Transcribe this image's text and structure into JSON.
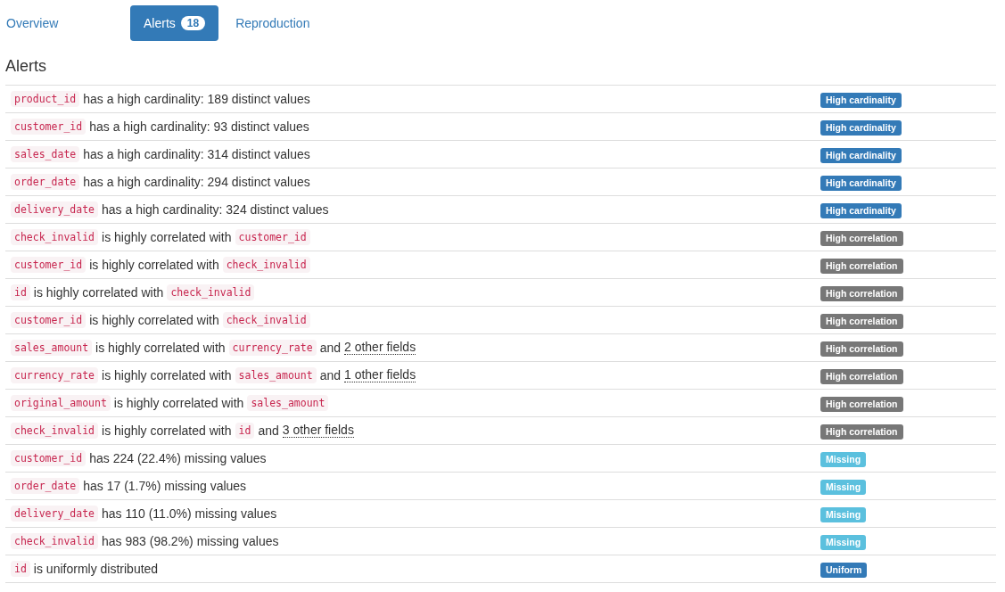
{
  "tabs": [
    {
      "label": "Overview",
      "selected": false
    },
    {
      "label": "Alerts",
      "selected": true,
      "badge": "18"
    },
    {
      "label": "Reproduction",
      "selected": false
    }
  ],
  "heading": "Alerts",
  "alerts": [
    {
      "parts": [
        {
          "kind": "code",
          "text": "product_id"
        },
        {
          "kind": "text",
          "text": "has a high cardinality: 189 distinct values"
        }
      ],
      "tag": "High cardinality",
      "color": "#337ab7"
    },
    {
      "parts": [
        {
          "kind": "code",
          "text": "customer_id"
        },
        {
          "kind": "text",
          "text": "has a high cardinality: 93 distinct values"
        }
      ],
      "tag": "High cardinality",
      "color": "#337ab7"
    },
    {
      "parts": [
        {
          "kind": "code",
          "text": "sales_date"
        },
        {
          "kind": "text",
          "text": "has a high cardinality: 314 distinct values"
        }
      ],
      "tag": "High cardinality",
      "color": "#337ab7"
    },
    {
      "parts": [
        {
          "kind": "code",
          "text": "order_date"
        },
        {
          "kind": "text",
          "text": "has a high cardinality: 294 distinct values"
        }
      ],
      "tag": "High cardinality",
      "color": "#337ab7"
    },
    {
      "parts": [
        {
          "kind": "code",
          "text": "delivery_date"
        },
        {
          "kind": "text",
          "text": "has a high cardinality: 324 distinct values"
        }
      ],
      "tag": "High cardinality",
      "color": "#337ab7"
    },
    {
      "parts": [
        {
          "kind": "code",
          "text": "check_invalid"
        },
        {
          "kind": "text",
          "text": "is highly correlated with"
        },
        {
          "kind": "code",
          "text": "customer_id"
        }
      ],
      "tag": "High correlation",
      "color": "#777777"
    },
    {
      "parts": [
        {
          "kind": "code",
          "text": "customer_id"
        },
        {
          "kind": "text",
          "text": "is highly correlated with"
        },
        {
          "kind": "code",
          "text": "check_invalid"
        }
      ],
      "tag": "High correlation",
      "color": "#777777"
    },
    {
      "parts": [
        {
          "kind": "code",
          "text": "id"
        },
        {
          "kind": "text",
          "text": "is highly correlated with"
        },
        {
          "kind": "code",
          "text": "check_invalid"
        }
      ],
      "tag": "High correlation",
      "color": "#777777"
    },
    {
      "parts": [
        {
          "kind": "code",
          "text": "customer_id"
        },
        {
          "kind": "text",
          "text": "is highly correlated with"
        },
        {
          "kind": "code",
          "text": "check_invalid"
        }
      ],
      "tag": "High correlation",
      "color": "#777777"
    },
    {
      "parts": [
        {
          "kind": "code",
          "text": "sales_amount"
        },
        {
          "kind": "text",
          "text": "is highly correlated with"
        },
        {
          "kind": "code",
          "text": "currency_rate"
        },
        {
          "kind": "text",
          "text": "and"
        },
        {
          "kind": "link",
          "text": "2 other fields"
        }
      ],
      "tag": "High correlation",
      "color": "#777777"
    },
    {
      "parts": [
        {
          "kind": "code",
          "text": "currency_rate"
        },
        {
          "kind": "text",
          "text": "is highly correlated with"
        },
        {
          "kind": "code",
          "text": "sales_amount"
        },
        {
          "kind": "text",
          "text": "and"
        },
        {
          "kind": "link",
          "text": "1 other fields"
        }
      ],
      "tag": "High correlation",
      "color": "#777777"
    },
    {
      "parts": [
        {
          "kind": "code",
          "text": "original_amount"
        },
        {
          "kind": "text",
          "text": "is highly correlated with"
        },
        {
          "kind": "code",
          "text": "sales_amount"
        }
      ],
      "tag": "High correlation",
      "color": "#777777"
    },
    {
      "parts": [
        {
          "kind": "code",
          "text": "check_invalid"
        },
        {
          "kind": "text",
          "text": "is highly correlated with"
        },
        {
          "kind": "code",
          "text": "id"
        },
        {
          "kind": "text",
          "text": "and"
        },
        {
          "kind": "link",
          "text": "3 other fields"
        }
      ],
      "tag": "High correlation",
      "color": "#777777"
    },
    {
      "parts": [
        {
          "kind": "code",
          "text": "customer_id"
        },
        {
          "kind": "text",
          "text": "has 224 (22.4%) missing values"
        }
      ],
      "tag": "Missing",
      "color": "#5bc0de"
    },
    {
      "parts": [
        {
          "kind": "code",
          "text": "order_date"
        },
        {
          "kind": "text",
          "text": "has 17 (1.7%) missing values"
        }
      ],
      "tag": "Missing",
      "color": "#5bc0de"
    },
    {
      "parts": [
        {
          "kind": "code",
          "text": "delivery_date"
        },
        {
          "kind": "text",
          "text": "has 110 (11.0%) missing values"
        }
      ],
      "tag": "Missing",
      "color": "#5bc0de"
    },
    {
      "parts": [
        {
          "kind": "code",
          "text": "check_invalid"
        },
        {
          "kind": "text",
          "text": "has 983 (98.2%) missing values"
        }
      ],
      "tag": "Missing",
      "color": "#5bc0de"
    },
    {
      "parts": [
        {
          "kind": "code",
          "text": "id"
        },
        {
          "kind": "text",
          "text": "is uniformly distributed"
        }
      ],
      "tag": "Uniform",
      "color": "#337ab7"
    }
  ]
}
